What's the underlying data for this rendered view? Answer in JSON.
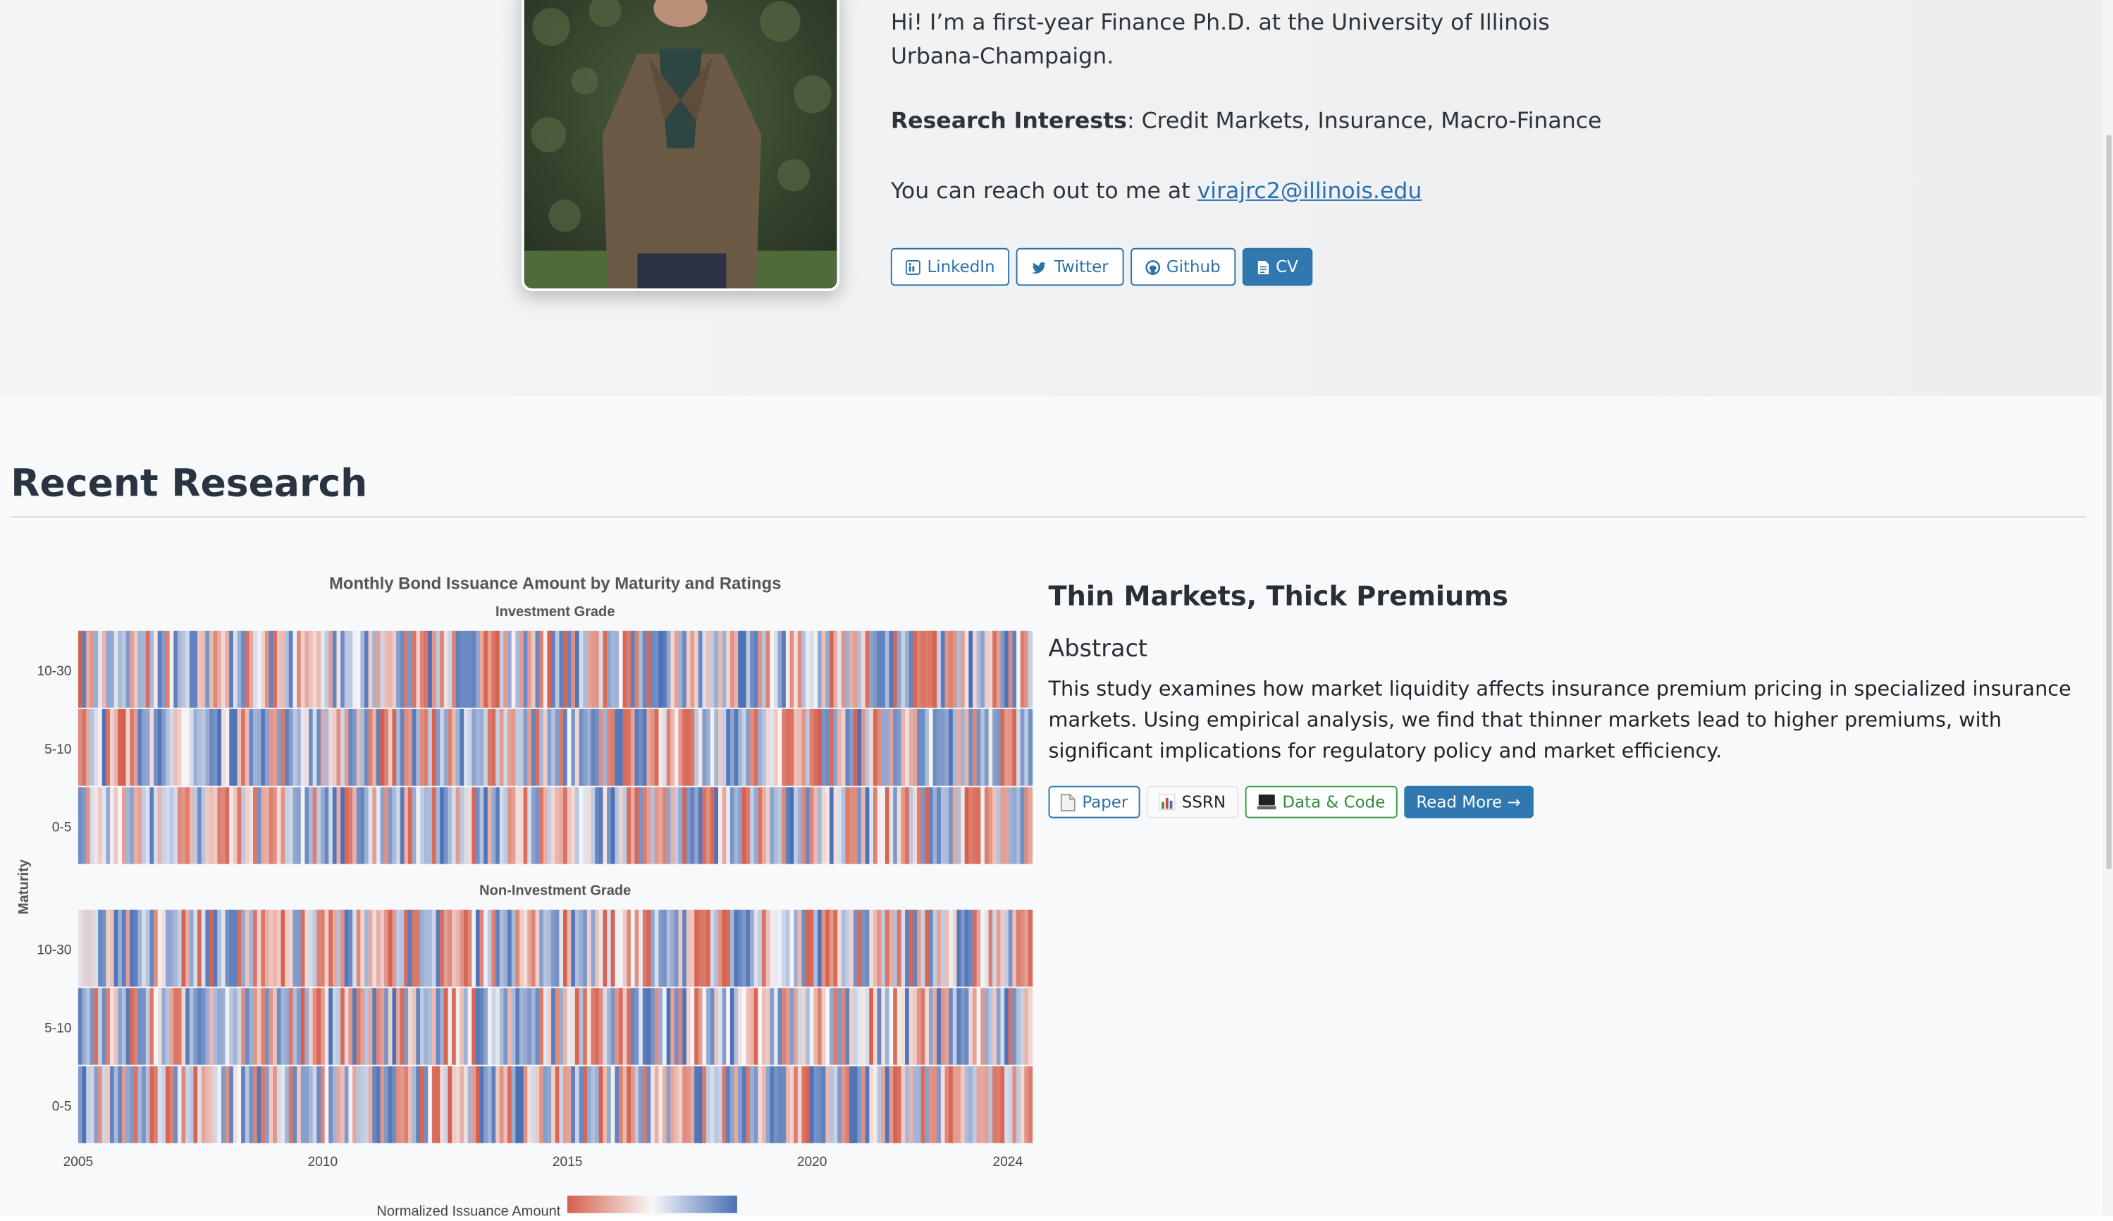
{
  "hero": {
    "bio": "Hi! I’m a first-year Finance Ph.D. at the University of Illinois Urbana-Champaign.",
    "interests_label": "Research Interests",
    "interests_value": ": Credit Markets, Insurance, Macro-Finance",
    "reach_prefix": "You can reach out to me at ",
    "email": "virajrc2@illinois.edu",
    "buttons": [
      {
        "label": "LinkedIn",
        "icon": "linkedin-icon"
      },
      {
        "label": "Twitter",
        "icon": "twitter-icon"
      },
      {
        "label": "Github",
        "icon": "github-icon"
      },
      {
        "label": "CV",
        "icon": "document-icon"
      }
    ]
  },
  "research": {
    "section_title": "Recent Research",
    "paper_title": "Thin Markets, Thick Premiums",
    "abstract_heading": "Abstract",
    "abstract": "This study examines how market liquidity affects insurance premium pricing in specialized insurance markets. Using empirical analysis, we find that thinner markets lead to higher premiums, with significant implications for regulatory policy and market efficiency.",
    "buttons": [
      {
        "label": "Paper",
        "icon": "document-icon"
      },
      {
        "label": "SSRN",
        "icon": "bar-chart-icon"
      },
      {
        "label": "Data & Code",
        "icon": "computer-icon"
      },
      {
        "label": "Read More →",
        "icon": ""
      }
    ]
  },
  "chart_data": {
    "type": "heatmap",
    "title": "Monthly Bond Issuance Amount by Maturity and Ratings",
    "ylabel": "Maturity",
    "colorbar_label": "Normalized Issuance Amount",
    "x_range": [
      2005,
      2024
    ],
    "x_ticks": [
      "2005",
      "2010",
      "2015",
      "2020",
      "2024"
    ],
    "rows": [
      "10-30",
      "5-10",
      "0-5"
    ],
    "panels": [
      {
        "name": "Investment Grade"
      },
      {
        "name": "Non-Investment Grade"
      }
    ],
    "colors": {
      "low": "#d6604d",
      "mid": "#f7f7f7",
      "high": "#4a6fb5"
    }
  }
}
